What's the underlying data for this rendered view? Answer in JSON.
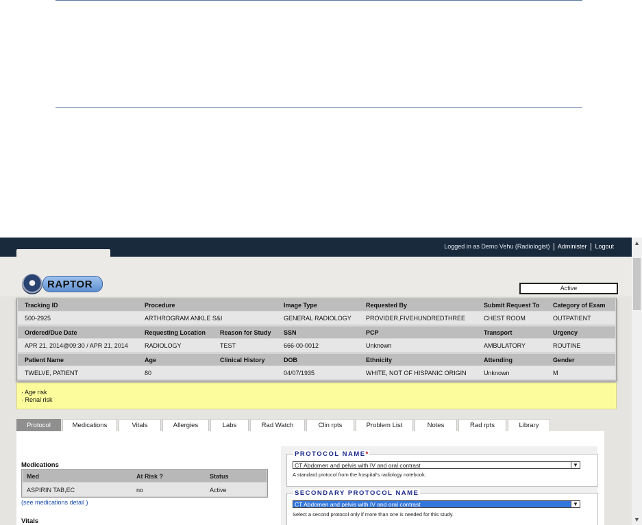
{
  "topbar": {
    "logged_in": "Logged in as Demo Vehu (Radiologist)",
    "administer": "Administer",
    "logout": "Logout"
  },
  "header": {
    "logo_text": "RAPTOR",
    "status": "Active"
  },
  "order": {
    "rows": [
      {
        "headers": [
          "Tracking ID",
          "Procedure",
          "Image Type",
          "Requested By",
          "Submit Request To",
          "Category of Exam"
        ],
        "values": [
          "500-2925",
          "ARTHROGRAM ANKLE S&I",
          "GENERAL RADIOLOGY",
          "PROVIDER,FIVEHUNDREDTHREE",
          "CHEST ROOM",
          "OUTPATIENT"
        ]
      },
      {
        "headers": [
          "Ordered/Due Date",
          "Requesting Location",
          "Reason for Study",
          "SSN",
          "PCP",
          "Transport",
          "Urgency"
        ],
        "values": [
          "APR 21, 2014@09:30 / APR 21, 2014",
          "RADIOLOGY",
          "TEST",
          "666-00-0012",
          "Unknown",
          "AMBULATORY",
          "ROUTINE"
        ]
      },
      {
        "headers": [
          "Patient Name",
          "Age",
          "Clinical History",
          "DOB",
          "Ethnicity",
          "Attending",
          "Gender"
        ],
        "values": [
          "TWELVE, PATIENT",
          "80",
          "",
          "04/07/1935",
          "WHITE, NOT OF HISPANIC ORIGIN",
          "Unknown",
          "M"
        ]
      }
    ]
  },
  "risks": [
    "· Age risk",
    "· Renal risk"
  ],
  "tabs": [
    "Protocol",
    "Medications",
    "Vitals",
    "Allergies",
    "Labs",
    "Rad Watch",
    "Clin rpts",
    "Problem List",
    "Notes",
    "Rad rpts",
    "Library"
  ],
  "medications": {
    "title": "Medications",
    "headers": [
      "Med",
      "At Risk ?",
      "Status"
    ],
    "row": [
      "ASPIRIN TAB,EC",
      "no",
      "Active"
    ],
    "detail_link": "(see medications detail )"
  },
  "vitals": {
    "title": "Vitals"
  },
  "protocol": {
    "legend": "PROTOCOL NAME",
    "required_mark": "*",
    "selected": "CT Abdomen and pelvis with IV and oral contrast",
    "help": "A standard protocol from the hospital's radiology notebook."
  },
  "secondary_protocol": {
    "legend": "SECONDARY PROTOCOL NAME",
    "selected": "CT Abdomen and pelvis with IV and oral contrast",
    "help": "Select a second protocol only if more than one is needed for this study."
  }
}
